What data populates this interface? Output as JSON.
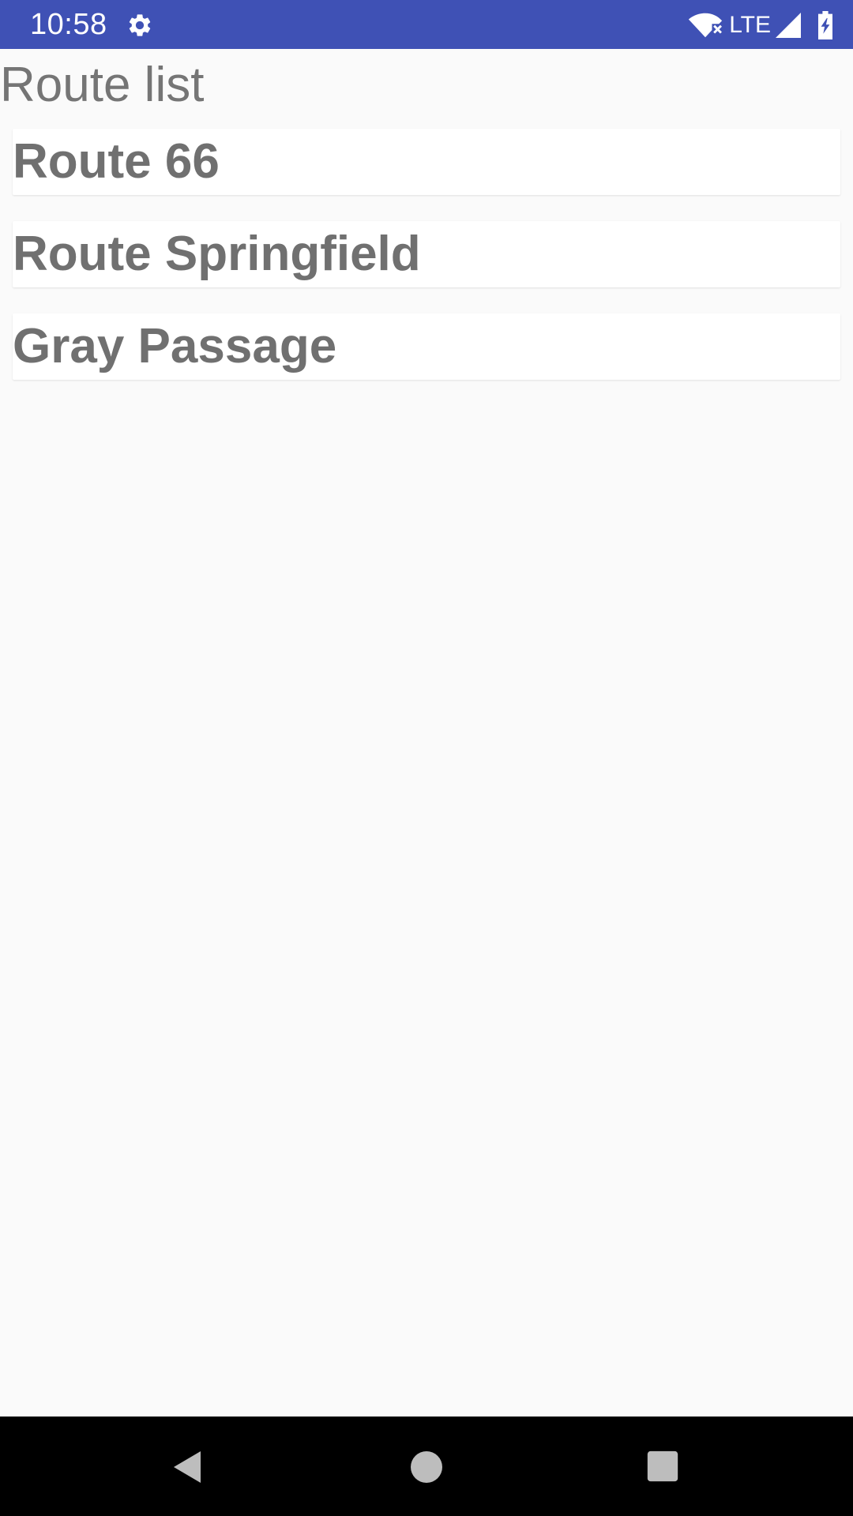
{
  "status_bar": {
    "time": "10:58",
    "network_label": "LTE",
    "icons": [
      "gear-icon",
      "wifi-off-icon",
      "signal-icon",
      "battery-charging-icon"
    ],
    "background_color": "#3f51b5"
  },
  "screen": {
    "title": "Route list"
  },
  "routes": [
    {
      "name": "Route 66"
    },
    {
      "name": "Route Springfield"
    },
    {
      "name": "Gray Passage"
    }
  ],
  "nav_bar": {
    "icons": [
      "back-icon",
      "home-icon",
      "recents-icon"
    ]
  }
}
